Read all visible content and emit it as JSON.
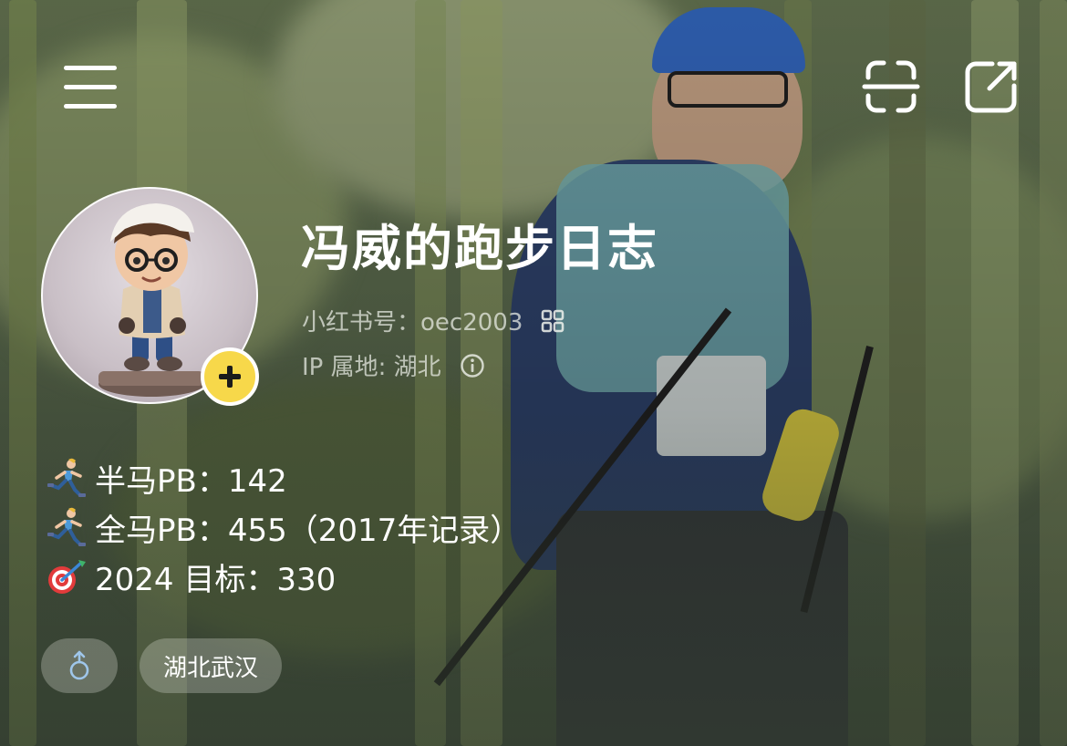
{
  "profile": {
    "nickname": "冯威的跑步日志",
    "account_id": "小红书号：oec2003",
    "ip_location": "IP 属地: 湖北"
  },
  "bio": {
    "lines": [
      {
        "emoji_icon": "runner-emoji-icon",
        "text": "半马PB：142"
      },
      {
        "emoji_icon": "runner-emoji-icon",
        "text": "全马PB：455（2017年记录）"
      },
      {
        "emoji_icon": "target-dart-emoji-icon",
        "text": "2024 目标：330"
      }
    ]
  },
  "tags": {
    "gender_icon": "male-gender-icon",
    "location": "湖北武汉"
  },
  "icons": {
    "menu": "menu-icon",
    "scan": "scan-icon",
    "share": "share-icon",
    "qr": "qr-code-icon",
    "info": "info-icon",
    "add": "plus-icon"
  },
  "colors": {
    "add_button": "#f7d84a",
    "gender_icon": "#9fc6ea"
  }
}
